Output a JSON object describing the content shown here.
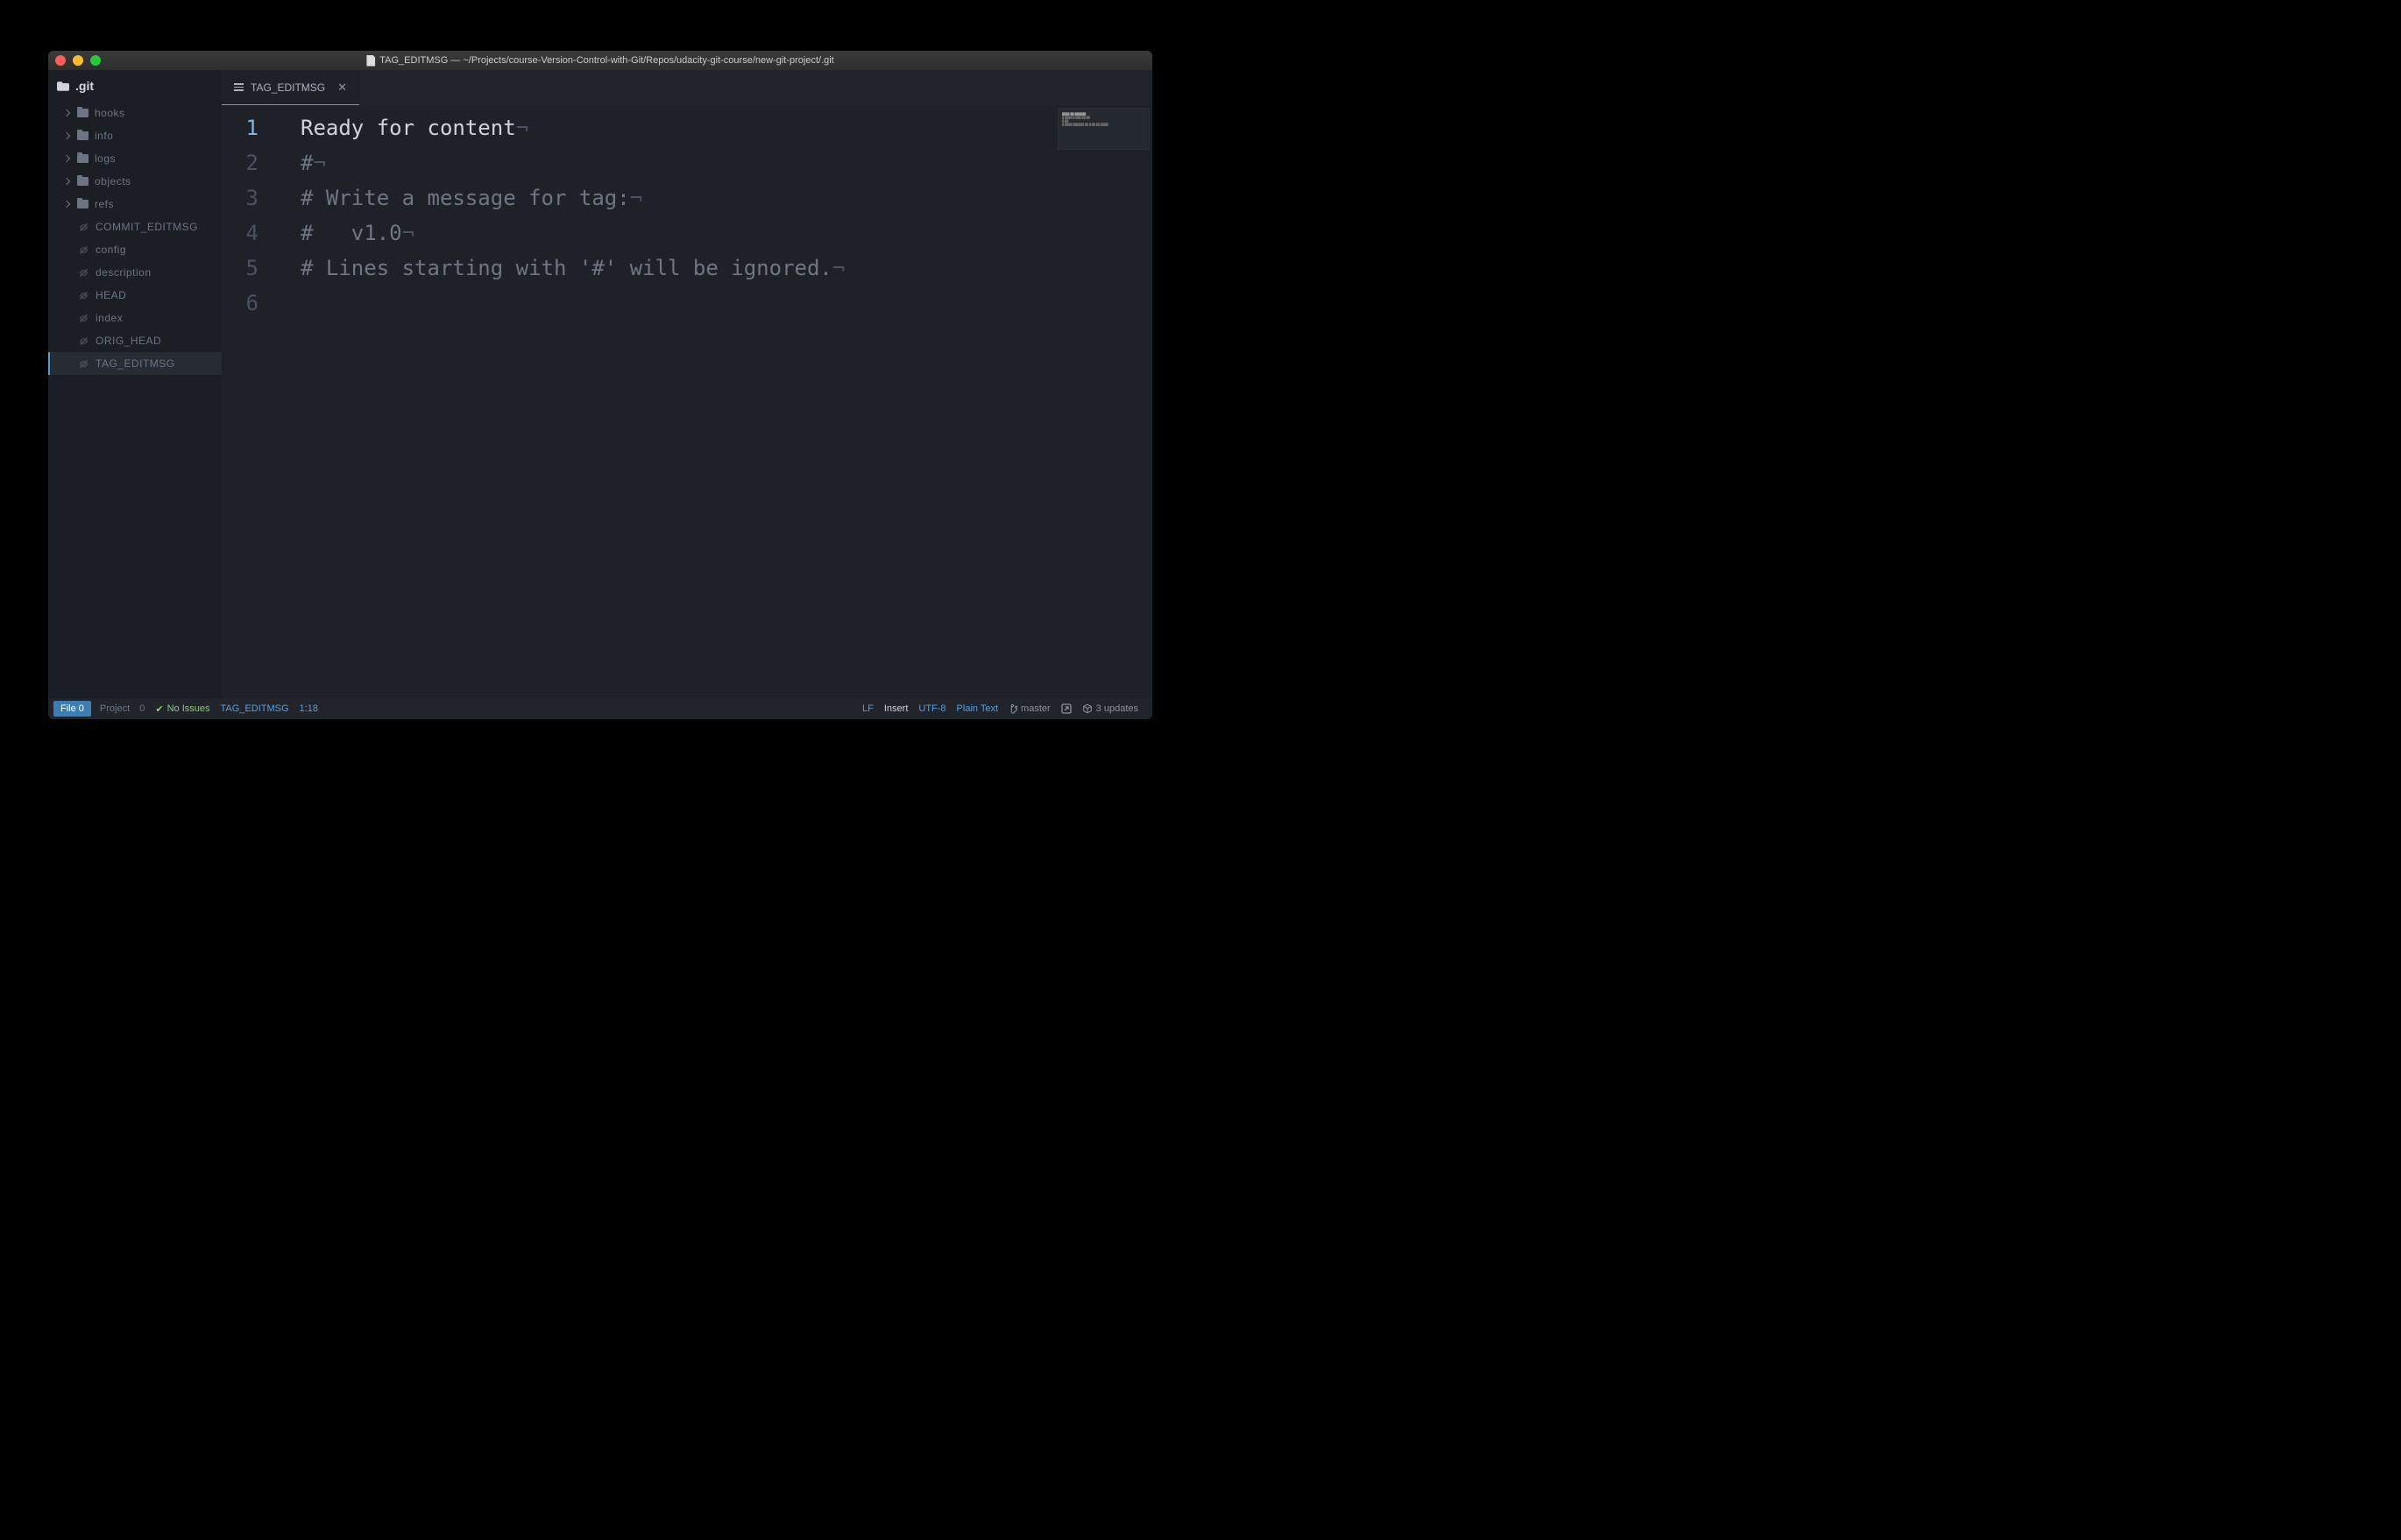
{
  "titlebar": {
    "title": "TAG_EDITMSG — ~/Projects/course-Version-Control-with-Git/Repos/udacity-git-course/new-git-project/.git"
  },
  "sidebar": {
    "project_name": ".git",
    "folders": [
      {
        "name": "hooks"
      },
      {
        "name": "info"
      },
      {
        "name": "logs"
      },
      {
        "name": "objects"
      },
      {
        "name": "refs"
      }
    ],
    "files": [
      {
        "name": "COMMIT_EDITMSG",
        "selected": false
      },
      {
        "name": "config",
        "selected": false
      },
      {
        "name": "description",
        "selected": false
      },
      {
        "name": "HEAD",
        "selected": false
      },
      {
        "name": "index",
        "selected": false
      },
      {
        "name": "ORIG_HEAD",
        "selected": false
      },
      {
        "name": "TAG_EDITMSG",
        "selected": true
      }
    ]
  },
  "tab": {
    "label": "TAG_EDITMSG"
  },
  "editor": {
    "lines": [
      {
        "n": "1",
        "text": "Ready for content",
        "cls": "content",
        "current": true
      },
      {
        "n": "2",
        "text": "#",
        "cls": "comment"
      },
      {
        "n": "3",
        "text": "# Write a message for tag:",
        "cls": "comment"
      },
      {
        "n": "4",
        "text": "#   v1.0",
        "cls": "comment"
      },
      {
        "n": "5",
        "text": "# Lines starting with '#' will be ignored.",
        "cls": "comment"
      },
      {
        "n": "6",
        "text": "",
        "cls": "comment"
      }
    ]
  },
  "statusbar": {
    "file_btn": "File",
    "file_count": "0",
    "project_label": "Project",
    "project_count": "0",
    "issues": "No Issues",
    "filename": "TAG_EDITMSG",
    "cursor": "1:18",
    "eol": "LF",
    "mode": "Insert",
    "encoding": "UTF-8",
    "grammar": "Plain Text",
    "branch": "master",
    "updates": "3 updates"
  }
}
